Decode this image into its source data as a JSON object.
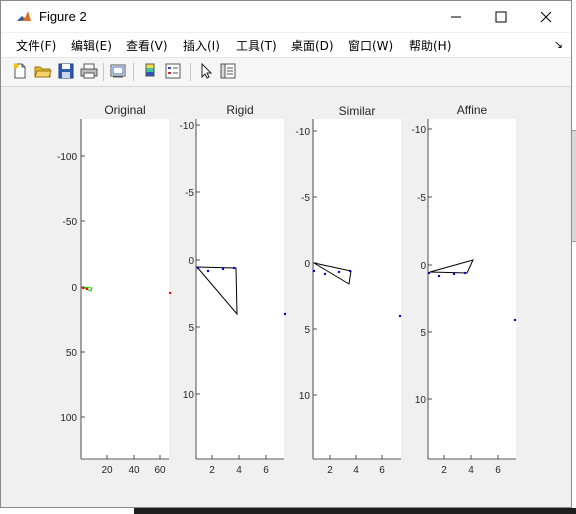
{
  "window": {
    "title": "Figure 2"
  },
  "menu": [
    "文件(F)",
    "编辑(E)",
    "查看(V)",
    "插入(I)",
    "工具(T)",
    "桌面(D)",
    "窗口(W)",
    "帮助(H)"
  ],
  "toolbar": {
    "buttons": [
      "new-figure-icon",
      "open-file-icon",
      "save-icon",
      "print-icon",
      "link-plot-icon",
      "colorbar-icon",
      "legend-icon",
      "pointer-icon",
      "property-inspector-icon"
    ]
  },
  "plots": [
    {
      "title": "Original",
      "yticks": [
        "-100",
        "-50",
        "0",
        "50",
        "100"
      ],
      "xticks": [
        "20",
        "40",
        "60"
      ]
    },
    {
      "title": "Rigid",
      "yticks": [
        "-10",
        "-5",
        "0",
        "5",
        "10"
      ],
      "xticks": [
        "2",
        "4",
        "6"
      ]
    },
    {
      "title": "Similar",
      "yticks": [
        "-10",
        "-5",
        "0",
        "5",
        "10"
      ],
      "xticks": [
        "2",
        "4",
        "6"
      ]
    },
    {
      "title": "Affine",
      "yticks": [
        "-10",
        "-5",
        "0",
        "5",
        "10"
      ],
      "xticks": [
        "2",
        "4",
        "6"
      ]
    }
  ],
  "colors": {
    "original_shape": "#00cc00",
    "points_red": "#ff0000",
    "points_blue": "#0000cc",
    "triangle": "#000000"
  }
}
